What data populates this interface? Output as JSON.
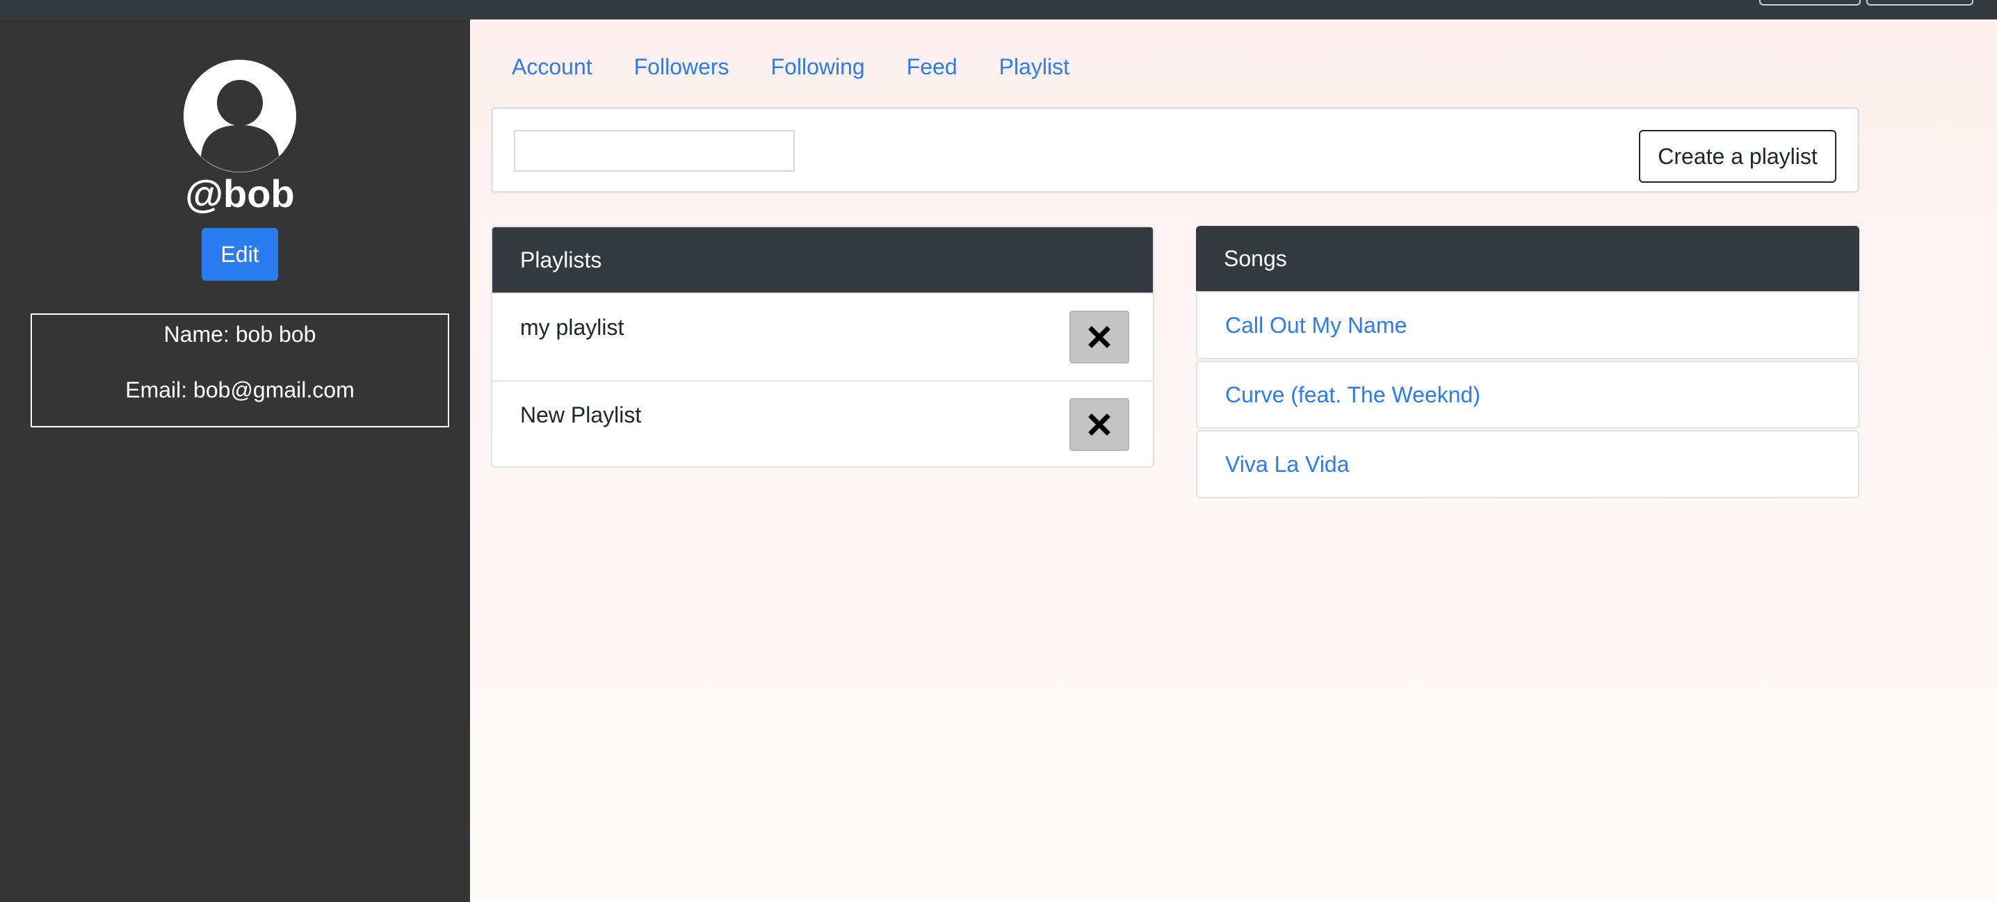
{
  "sidebar": {
    "username": "@bob",
    "edit_label": "Edit",
    "name_line": "Name: bob bob",
    "email_line": "Email: bob@gmail.com"
  },
  "nav": {
    "tabs": [
      "Account",
      "Followers",
      "Following",
      "Feed",
      "Playlist"
    ]
  },
  "toolbar": {
    "search_value": "",
    "create_label": "Create a playlist"
  },
  "playlists": {
    "title": "Playlists",
    "items": [
      "my playlist",
      "New Playlist"
    ]
  },
  "songs": {
    "title": "Songs",
    "items": [
      "Call Out My Name",
      "Curve (feat. The Weeknd)",
      "Viva La Vida"
    ]
  },
  "icons": {
    "avatar": "user-avatar-icon",
    "remove": "close-x-icon"
  },
  "colors": {
    "accent": "#2a7cf0",
    "sidebar_bg": "#353535",
    "header_bg": "#343a40"
  }
}
